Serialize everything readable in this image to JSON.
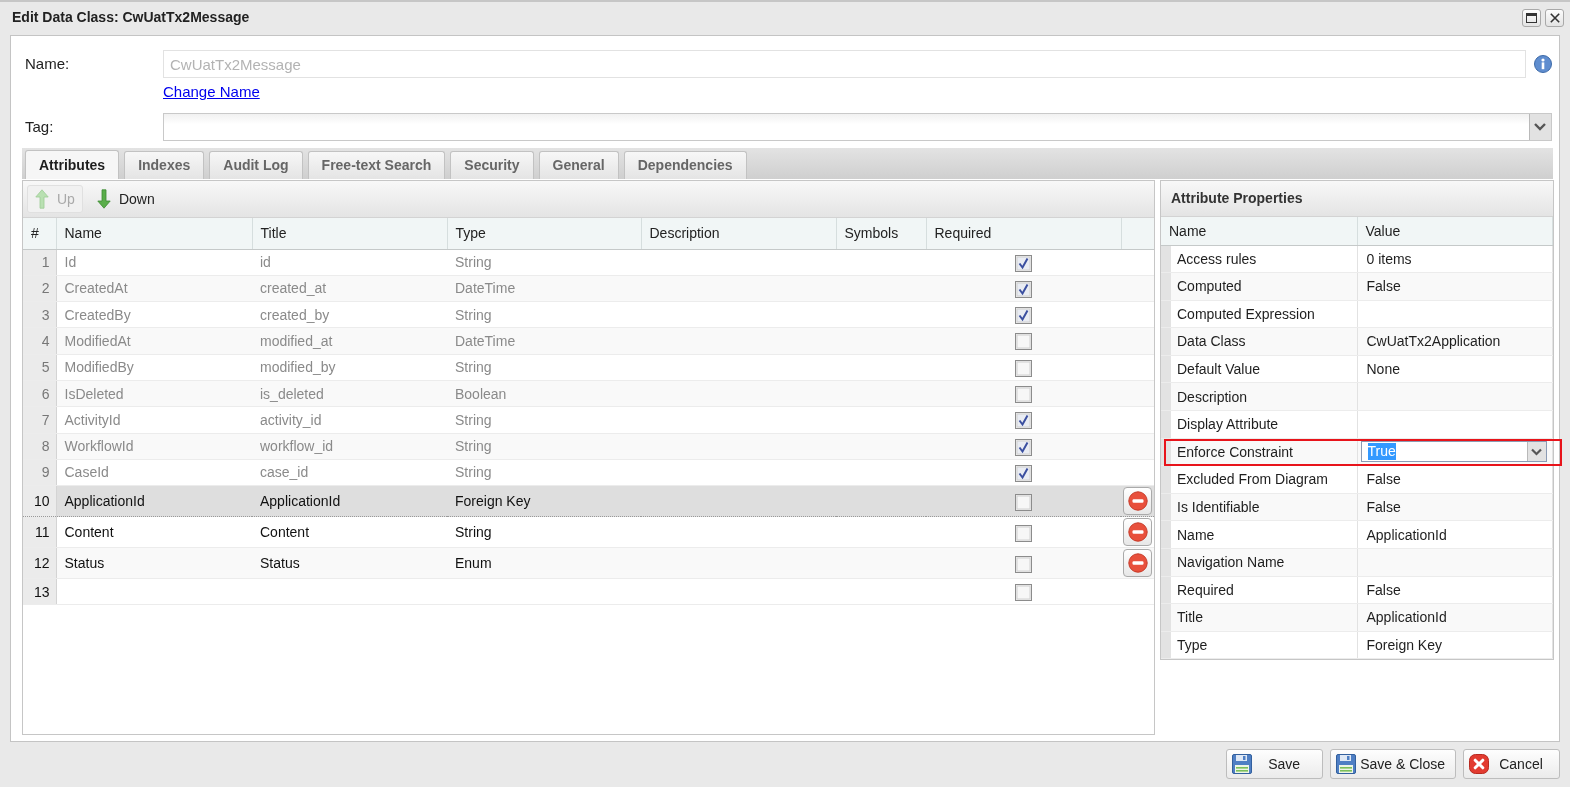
{
  "window": {
    "title": "Edit Data Class: CwUatTx2Message"
  },
  "form": {
    "name_label": "Name:",
    "name_field": {
      "value": "CwUatTx2Message",
      "disabled": true
    },
    "change_name_link": "Change Name",
    "tag_label": "Tag:"
  },
  "tabs": [
    {
      "label": "Attributes",
      "selected": true
    },
    {
      "label": "Indexes",
      "selected": false
    },
    {
      "label": "Audit Log",
      "selected": false
    },
    {
      "label": "Free-text Search",
      "selected": false
    },
    {
      "label": "Security",
      "selected": false
    },
    {
      "label": "General",
      "selected": false
    },
    {
      "label": "Dependencies",
      "selected": false
    }
  ],
  "attributes": {
    "toolbar": [
      {
        "kind": "up",
        "label": "Up",
        "disabled": true
      },
      {
        "kind": "down",
        "label": "Down",
        "disabled": false
      }
    ],
    "columns": [
      "#",
      "Name",
      "Title",
      "Type",
      "Description",
      "Symbols",
      "Required"
    ],
    "rows": [
      {
        "number": "1",
        "name": "Id",
        "title": "id",
        "type": "String",
        "required": true,
        "read_only": true,
        "selected": false,
        "deletable": false
      },
      {
        "number": "2",
        "name": "CreatedAt",
        "title": "created_at",
        "type": "DateTime",
        "required": true,
        "read_only": true,
        "selected": false,
        "deletable": false
      },
      {
        "number": "3",
        "name": "CreatedBy",
        "title": "created_by",
        "type": "String",
        "required": true,
        "read_only": true,
        "selected": false,
        "deletable": false
      },
      {
        "number": "4",
        "name": "ModifiedAt",
        "title": "modified_at",
        "type": "DateTime",
        "required": false,
        "read_only": true,
        "selected": false,
        "deletable": false
      },
      {
        "number": "5",
        "name": "ModifiedBy",
        "title": "modified_by",
        "type": "String",
        "required": false,
        "read_only": true,
        "selected": false,
        "deletable": false
      },
      {
        "number": "6",
        "name": "IsDeleted",
        "title": "is_deleted",
        "type": "Boolean",
        "required": false,
        "read_only": true,
        "selected": false,
        "deletable": false
      },
      {
        "number": "7",
        "name": "ActivityId",
        "title": "activity_id",
        "type": "String",
        "required": true,
        "read_only": true,
        "selected": false,
        "deletable": false
      },
      {
        "number": "8",
        "name": "WorkflowId",
        "title": "workflow_id",
        "type": "String",
        "required": true,
        "read_only": true,
        "selected": false,
        "deletable": false
      },
      {
        "number": "9",
        "name": "CaseId",
        "title": "case_id",
        "type": "String",
        "required": true,
        "read_only": true,
        "selected": false,
        "deletable": false
      },
      {
        "number": "10",
        "name": "ApplicationId",
        "title": "ApplicationId",
        "type": "Foreign Key",
        "required": false,
        "read_only": false,
        "selected": true,
        "deletable": true
      },
      {
        "number": "11",
        "name": "Content",
        "title": "Content",
        "type": "String",
        "required": false,
        "read_only": false,
        "selected": false,
        "deletable": true
      },
      {
        "number": "12",
        "name": "Status",
        "title": "Status",
        "type": "Enum",
        "required": false,
        "read_only": false,
        "selected": false,
        "deletable": true
      },
      {
        "number": "13",
        "required": false,
        "read_only": false,
        "selected": false,
        "deletable": false
      }
    ]
  },
  "properties": {
    "title": "Attribute Properties",
    "columns": [
      "Name",
      "Value"
    ],
    "rows": [
      {
        "name": "Access rules",
        "value": "0 items",
        "editing": false,
        "highlighted": false
      },
      {
        "name": "Computed",
        "value": "False",
        "editing": false,
        "highlighted": false
      },
      {
        "name": "Computed Expression",
        "editing": false,
        "highlighted": false
      },
      {
        "name": "Data Class",
        "value": "CwUatTx2Application",
        "editing": false,
        "highlighted": false
      },
      {
        "name": "Default Value",
        "value": "None",
        "editing": false,
        "highlighted": false
      },
      {
        "name": "Description",
        "editing": false,
        "highlighted": false
      },
      {
        "name": "Display Attribute",
        "editing": false,
        "highlighted": false
      },
      {
        "name": "Enforce Constraint",
        "value": "True",
        "editing": true,
        "highlighted": true
      },
      {
        "name": "Excluded From Diagram",
        "value": "False",
        "editing": false,
        "highlighted": false
      },
      {
        "name": "Is Identifiable",
        "value": "False",
        "editing": false,
        "highlighted": false
      },
      {
        "name": "Name",
        "value": "ApplicationId",
        "editing": false,
        "highlighted": false
      },
      {
        "name": "Navigation Name",
        "editing": false,
        "highlighted": false
      },
      {
        "name": "Required",
        "value": "False",
        "editing": false,
        "highlighted": false
      },
      {
        "name": "Title",
        "value": "ApplicationId",
        "editing": false,
        "highlighted": false
      },
      {
        "name": "Type",
        "value": "Foreign Key",
        "editing": false,
        "highlighted": false
      }
    ]
  },
  "buttons": [
    {
      "kind": "save",
      "label": "Save"
    },
    {
      "kind": "save_close",
      "label": "Save & Close"
    },
    {
      "kind": "cancel",
      "label": "Cancel"
    }
  ]
}
